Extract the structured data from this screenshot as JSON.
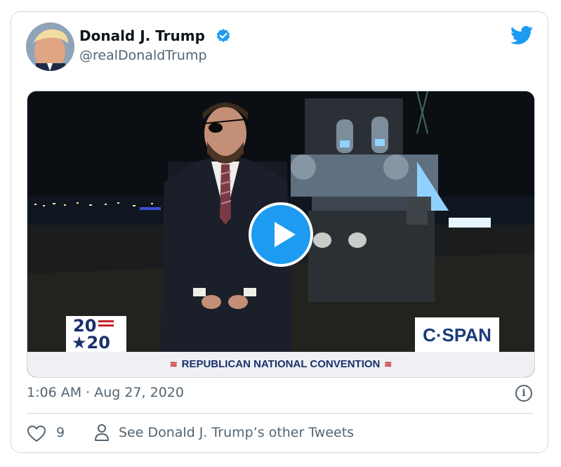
{
  "tweet": {
    "author_name": "Donald J. Trump",
    "handle": "@realDonaldTrump",
    "timestamp": "1:06 AM · Aug 27, 2020",
    "like_count": "9",
    "other_tweets_link": "See Donald J. Trump’s other Tweets"
  },
  "video": {
    "badge_2020_top": "20",
    "badge_2020_bottom": "★20",
    "network_logo": "C·SPAN",
    "lower_third": "REPUBLICAN NATIONAL CONVENTION"
  },
  "icons": {
    "verified": "verified-badge-icon",
    "brand": "twitter-bird-icon",
    "play": "play-icon",
    "info": "info-icon",
    "like": "heart-icon",
    "profile": "person-icon"
  },
  "colors": {
    "accent": "#1d9bf0",
    "secondary_text": "#536471",
    "border": "#cfd9de"
  }
}
